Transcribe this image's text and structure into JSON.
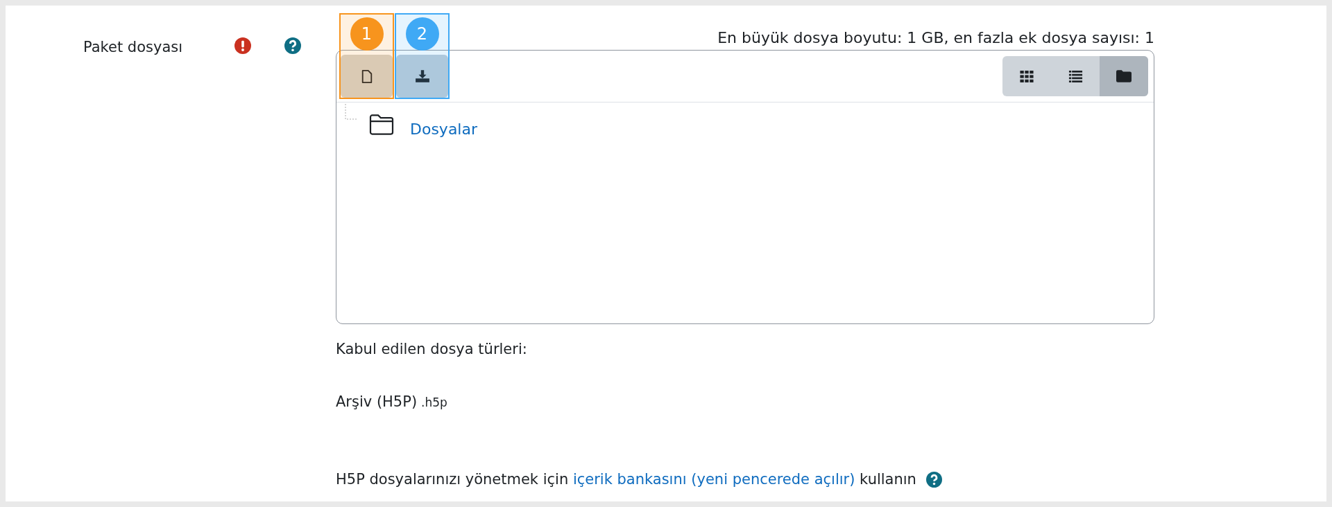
{
  "field": {
    "label": "Paket dosyası",
    "required": true,
    "help": true
  },
  "limits": "En büyük dosya boyutu: 1 GB, en fazla ek dosya sayısı: 1",
  "toolbar": [
    {
      "kind": "add-file",
      "badge": "1",
      "color": "#f7941d"
    },
    {
      "kind": "download",
      "badge": "2",
      "color": "#3fa9f5"
    }
  ],
  "views": [
    {
      "kind": "icons",
      "selected": false
    },
    {
      "kind": "list",
      "selected": false
    },
    {
      "kind": "tree",
      "selected": true
    }
  ],
  "tree": [
    {
      "name": "Dosyalar"
    }
  ],
  "accepted_label": "Kabul edilen dosya türleri:",
  "accepted_types": [
    {
      "name": "Arşiv (H5P)",
      "extension": ".h5p"
    }
  ],
  "footer": {
    "before": "H5P dosyalarınızı yönetmek için",
    "link": "içerik bankasını (yeni pencerede açılır)",
    "after": "kullanın",
    "help": true
  }
}
